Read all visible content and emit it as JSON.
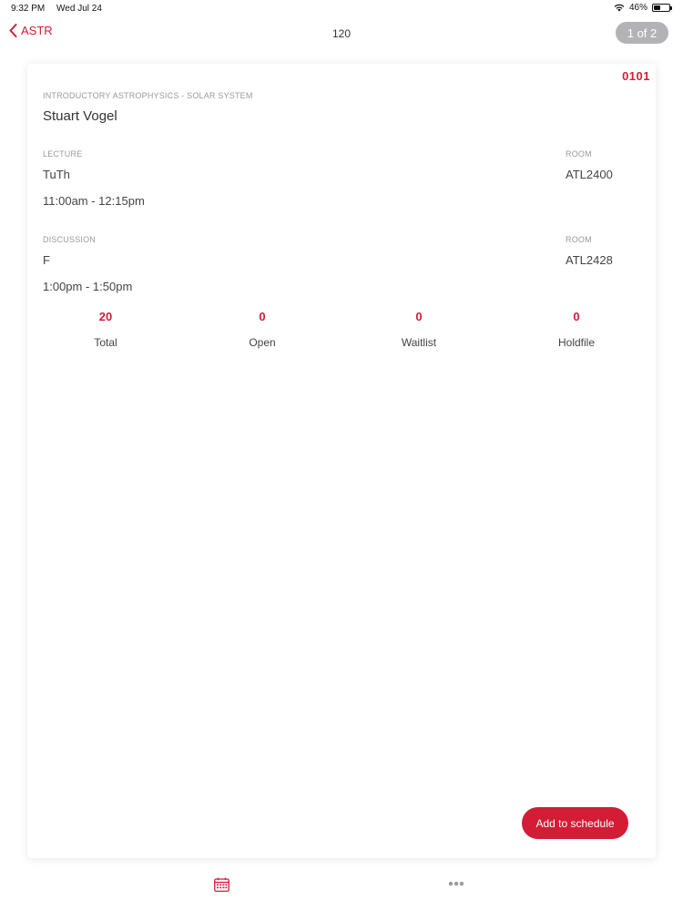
{
  "status": {
    "time": "9:32 PM",
    "date": "Wed Jul 24",
    "battery": "46%",
    "battery_level": 0.46
  },
  "nav": {
    "back_label": "ASTR",
    "title": "120",
    "pager": "1 of 2"
  },
  "card": {
    "section_number": "0101",
    "course_name": "INTRODUCTORY ASTROPHYSICS - SOLAR SYSTEM",
    "instructor": "Stuart Vogel",
    "meetings": [
      {
        "type_label": "LECTURE",
        "room_label": "ROOM",
        "days": "TuTh",
        "room": "ATL2400",
        "time": "11:00am - 12:15pm"
      },
      {
        "type_label": "DISCUSSION",
        "room_label": "ROOM",
        "days": "F",
        "room": "ATL2428",
        "time": "1:00pm - 1:50pm"
      }
    ],
    "stats": [
      {
        "value": "20",
        "label": "Total"
      },
      {
        "value": "0",
        "label": "Open"
      },
      {
        "value": "0",
        "label": "Waitlist"
      },
      {
        "value": "0",
        "label": "Holdfile"
      }
    ],
    "add_button_label": "Add to schedule"
  },
  "tabs": [
    {
      "icon": "calendar-icon"
    },
    {
      "icon": "more-icon"
    }
  ],
  "colors": {
    "accent": "#d31c36",
    "pill": "#b3b3b7"
  }
}
